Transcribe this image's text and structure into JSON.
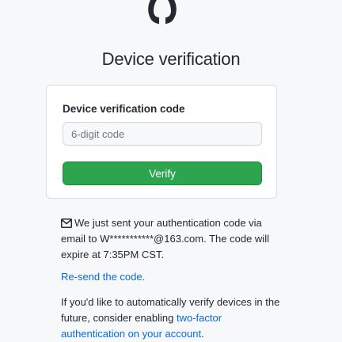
{
  "header": {
    "logo_icon": "github-mark-icon",
    "title": "Device verification"
  },
  "card": {
    "label": "Device verification code",
    "code_input": {
      "value": "",
      "placeholder": "6-digit code"
    },
    "verify_label": "Verify"
  },
  "info": {
    "icon": "mail-icon",
    "text": "We just sent your authentication code via email to W***********@163.com. The code will expire at 7:35PM CST."
  },
  "resend": {
    "text": "Re-send the code",
    "suffix": "."
  },
  "twofa": {
    "prefix": "If you'd like to automatically verify devices in the future, consider enabling ",
    "link_text": "two-factor authentication on your account",
    "suffix": "."
  },
  "colors": {
    "accent": "#0969da",
    "button": "#2da44e",
    "background": "#f6f8fa"
  }
}
